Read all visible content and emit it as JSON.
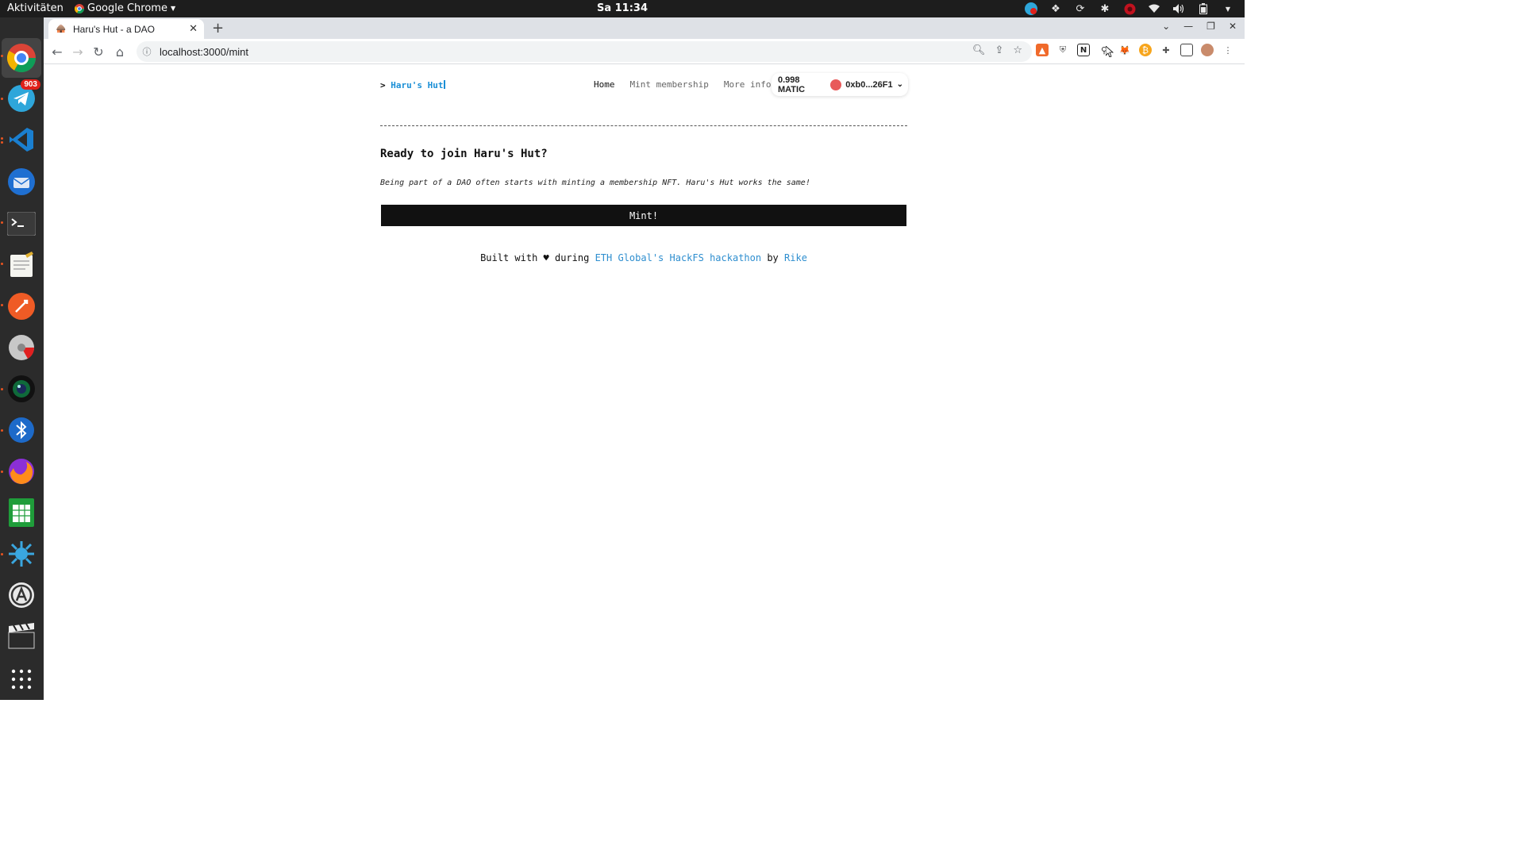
{
  "topbar": {
    "activities": "Aktivitäten",
    "app_name": "Google Chrome",
    "clock": "Sa 11:34"
  },
  "dock": {
    "telegram_badge": "903"
  },
  "browser": {
    "tab_title": "Haru's Hut - a DAO",
    "url": "localhost:3000/mint"
  },
  "site": {
    "brand_prefix": ">",
    "brand_name": "Haru's Hut",
    "nav": {
      "home": "Home",
      "mint": "Mint membership",
      "more": "More info"
    },
    "wallet": {
      "balance": "0.998 MATIC",
      "account": "0xb0...26F1"
    },
    "heading": "Ready to join Haru's Hut?",
    "description": "Being part of a DAO often starts with minting a membership NFT. Haru's Hut works the same!",
    "mint_button": "Mint!",
    "footer": {
      "built_with": "Built with ♥ during",
      "event_link": "ETH Global's HackFS hackathon",
      "by": "by",
      "author_link": "Rike"
    }
  }
}
